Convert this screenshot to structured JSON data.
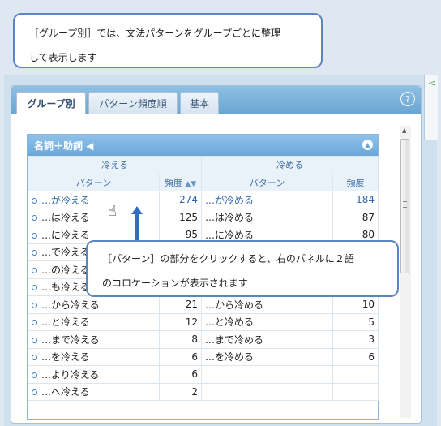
{
  "callout_top": {
    "line1": "［グループ別］では、文法パターンをグループごとに整理",
    "line2": "して表示します"
  },
  "callout_mid": {
    "line1": "［パターン］の部分をクリックすると、右のパネルに２語",
    "line2": "のコロケーションが表示されます"
  },
  "tabs": [
    {
      "label": "グループ別"
    },
    {
      "label": "パターン頻度順"
    },
    {
      "label": "基本"
    }
  ],
  "help_icon": "?",
  "group_title": "名詞＋助詞 ◀",
  "columns": {
    "left_group": "冷える",
    "right_group": "冷める",
    "pattern": "パターン",
    "freq": "頻度"
  },
  "rows": [
    {
      "lp": "…が冷える",
      "lf": "274",
      "rp": "…が冷める",
      "rf": "184"
    },
    {
      "lp": "…は冷える",
      "lf": "125",
      "rp": "…は冷める",
      "rf": "87"
    },
    {
      "lp": "…に冷える",
      "lf": "95",
      "rp": "…に冷める",
      "rf": "80"
    },
    {
      "lp": "…で冷える",
      "lf": "",
      "rp": "",
      "rf": ""
    },
    {
      "lp": "…の冷える",
      "lf": "",
      "rp": "",
      "rf": ""
    },
    {
      "lp": "…も冷える",
      "lf": "",
      "rp": "",
      "rf": ""
    },
    {
      "lp": "…から冷える",
      "lf": "21",
      "rp": "…から冷める",
      "rf": "10"
    },
    {
      "lp": "…と冷える",
      "lf": "12",
      "rp": "…と冷める",
      "rf": "5"
    },
    {
      "lp": "…まで冷える",
      "lf": "8",
      "rp": "…まで冷める",
      "rf": "3"
    },
    {
      "lp": "…を冷える",
      "lf": "6",
      "rp": "…を冷める",
      "rf": "6"
    },
    {
      "lp": "…より冷える",
      "lf": "6",
      "rp": "",
      "rf": ""
    },
    {
      "lp": "…へ冷える",
      "lf": "2",
      "rp": "",
      "rf": ""
    }
  ]
}
